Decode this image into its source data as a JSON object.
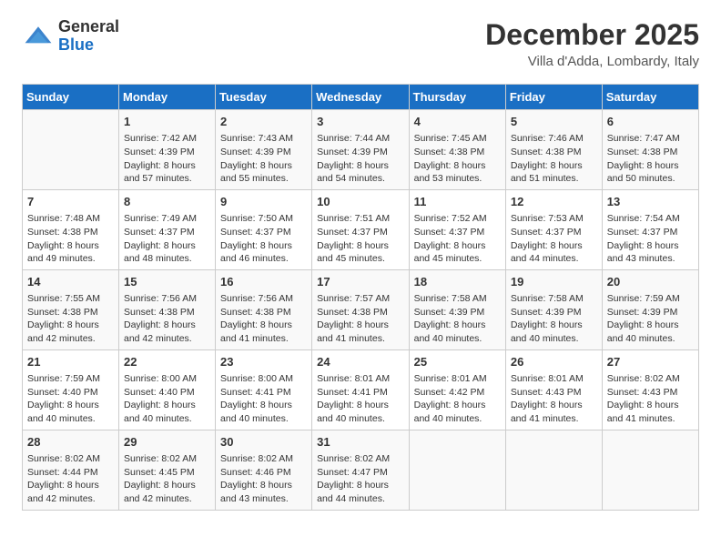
{
  "header": {
    "logo_general": "General",
    "logo_blue": "Blue",
    "month_year": "December 2025",
    "location": "Villa d'Adda, Lombardy, Italy"
  },
  "days_of_week": [
    "Sunday",
    "Monday",
    "Tuesday",
    "Wednesday",
    "Thursday",
    "Friday",
    "Saturday"
  ],
  "weeks": [
    [
      {
        "day": "",
        "sunrise": "",
        "sunset": "",
        "daylight": ""
      },
      {
        "day": "1",
        "sunrise": "Sunrise: 7:42 AM",
        "sunset": "Sunset: 4:39 PM",
        "daylight": "Daylight: 8 hours and 57 minutes."
      },
      {
        "day": "2",
        "sunrise": "Sunrise: 7:43 AM",
        "sunset": "Sunset: 4:39 PM",
        "daylight": "Daylight: 8 hours and 55 minutes."
      },
      {
        "day": "3",
        "sunrise": "Sunrise: 7:44 AM",
        "sunset": "Sunset: 4:39 PM",
        "daylight": "Daylight: 8 hours and 54 minutes."
      },
      {
        "day": "4",
        "sunrise": "Sunrise: 7:45 AM",
        "sunset": "Sunset: 4:38 PM",
        "daylight": "Daylight: 8 hours and 53 minutes."
      },
      {
        "day": "5",
        "sunrise": "Sunrise: 7:46 AM",
        "sunset": "Sunset: 4:38 PM",
        "daylight": "Daylight: 8 hours and 51 minutes."
      },
      {
        "day": "6",
        "sunrise": "Sunrise: 7:47 AM",
        "sunset": "Sunset: 4:38 PM",
        "daylight": "Daylight: 8 hours and 50 minutes."
      }
    ],
    [
      {
        "day": "7",
        "sunrise": "Sunrise: 7:48 AM",
        "sunset": "Sunset: 4:38 PM",
        "daylight": "Daylight: 8 hours and 49 minutes."
      },
      {
        "day": "8",
        "sunrise": "Sunrise: 7:49 AM",
        "sunset": "Sunset: 4:37 PM",
        "daylight": "Daylight: 8 hours and 48 minutes."
      },
      {
        "day": "9",
        "sunrise": "Sunrise: 7:50 AM",
        "sunset": "Sunset: 4:37 PM",
        "daylight": "Daylight: 8 hours and 46 minutes."
      },
      {
        "day": "10",
        "sunrise": "Sunrise: 7:51 AM",
        "sunset": "Sunset: 4:37 PM",
        "daylight": "Daylight: 8 hours and 45 minutes."
      },
      {
        "day": "11",
        "sunrise": "Sunrise: 7:52 AM",
        "sunset": "Sunset: 4:37 PM",
        "daylight": "Daylight: 8 hours and 45 minutes."
      },
      {
        "day": "12",
        "sunrise": "Sunrise: 7:53 AM",
        "sunset": "Sunset: 4:37 PM",
        "daylight": "Daylight: 8 hours and 44 minutes."
      },
      {
        "day": "13",
        "sunrise": "Sunrise: 7:54 AM",
        "sunset": "Sunset: 4:37 PM",
        "daylight": "Daylight: 8 hours and 43 minutes."
      }
    ],
    [
      {
        "day": "14",
        "sunrise": "Sunrise: 7:55 AM",
        "sunset": "Sunset: 4:38 PM",
        "daylight": "Daylight: 8 hours and 42 minutes."
      },
      {
        "day": "15",
        "sunrise": "Sunrise: 7:56 AM",
        "sunset": "Sunset: 4:38 PM",
        "daylight": "Daylight: 8 hours and 42 minutes."
      },
      {
        "day": "16",
        "sunrise": "Sunrise: 7:56 AM",
        "sunset": "Sunset: 4:38 PM",
        "daylight": "Daylight: 8 hours and 41 minutes."
      },
      {
        "day": "17",
        "sunrise": "Sunrise: 7:57 AM",
        "sunset": "Sunset: 4:38 PM",
        "daylight": "Daylight: 8 hours and 41 minutes."
      },
      {
        "day": "18",
        "sunrise": "Sunrise: 7:58 AM",
        "sunset": "Sunset: 4:39 PM",
        "daylight": "Daylight: 8 hours and 40 minutes."
      },
      {
        "day": "19",
        "sunrise": "Sunrise: 7:58 AM",
        "sunset": "Sunset: 4:39 PM",
        "daylight": "Daylight: 8 hours and 40 minutes."
      },
      {
        "day": "20",
        "sunrise": "Sunrise: 7:59 AM",
        "sunset": "Sunset: 4:39 PM",
        "daylight": "Daylight: 8 hours and 40 minutes."
      }
    ],
    [
      {
        "day": "21",
        "sunrise": "Sunrise: 7:59 AM",
        "sunset": "Sunset: 4:40 PM",
        "daylight": "Daylight: 8 hours and 40 minutes."
      },
      {
        "day": "22",
        "sunrise": "Sunrise: 8:00 AM",
        "sunset": "Sunset: 4:40 PM",
        "daylight": "Daylight: 8 hours and 40 minutes."
      },
      {
        "day": "23",
        "sunrise": "Sunrise: 8:00 AM",
        "sunset": "Sunset: 4:41 PM",
        "daylight": "Daylight: 8 hours and 40 minutes."
      },
      {
        "day": "24",
        "sunrise": "Sunrise: 8:01 AM",
        "sunset": "Sunset: 4:41 PM",
        "daylight": "Daylight: 8 hours and 40 minutes."
      },
      {
        "day": "25",
        "sunrise": "Sunrise: 8:01 AM",
        "sunset": "Sunset: 4:42 PM",
        "daylight": "Daylight: 8 hours and 40 minutes."
      },
      {
        "day": "26",
        "sunrise": "Sunrise: 8:01 AM",
        "sunset": "Sunset: 4:43 PM",
        "daylight": "Daylight: 8 hours and 41 minutes."
      },
      {
        "day": "27",
        "sunrise": "Sunrise: 8:02 AM",
        "sunset": "Sunset: 4:43 PM",
        "daylight": "Daylight: 8 hours and 41 minutes."
      }
    ],
    [
      {
        "day": "28",
        "sunrise": "Sunrise: 8:02 AM",
        "sunset": "Sunset: 4:44 PM",
        "daylight": "Daylight: 8 hours and 42 minutes."
      },
      {
        "day": "29",
        "sunrise": "Sunrise: 8:02 AM",
        "sunset": "Sunset: 4:45 PM",
        "daylight": "Daylight: 8 hours and 42 minutes."
      },
      {
        "day": "30",
        "sunrise": "Sunrise: 8:02 AM",
        "sunset": "Sunset: 4:46 PM",
        "daylight": "Daylight: 8 hours and 43 minutes."
      },
      {
        "day": "31",
        "sunrise": "Sunrise: 8:02 AM",
        "sunset": "Sunset: 4:47 PM",
        "daylight": "Daylight: 8 hours and 44 minutes."
      },
      {
        "day": "",
        "sunrise": "",
        "sunset": "",
        "daylight": ""
      },
      {
        "day": "",
        "sunrise": "",
        "sunset": "",
        "daylight": ""
      },
      {
        "day": "",
        "sunrise": "",
        "sunset": "",
        "daylight": ""
      }
    ]
  ]
}
